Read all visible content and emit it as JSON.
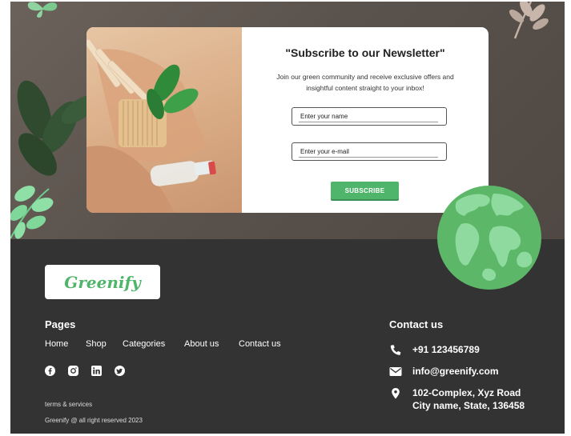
{
  "newsletter": {
    "title": "\"Subscribe to our Newsletter\"",
    "description": "Join our green community and receive exclusive offers and insightful content straight to your inbox!",
    "name_placeholder": "Enter your name",
    "email_placeholder": "Enter your e-mail",
    "button_label": "SUBSCRIBE"
  },
  "footer": {
    "logo_text": "Greenify",
    "pages_title": "Pages",
    "nav": [
      "Home",
      "Shop",
      "Categories",
      "About us",
      "Contact us"
    ],
    "socials": [
      "facebook-icon",
      "instagram-icon",
      "linkedin-icon",
      "twitter-icon"
    ],
    "terms": "terms & services",
    "copyright": "Greenify @ all right reserved 2023",
    "contact_title": "Contact us",
    "phone": "+91 123456789",
    "email": "info@greenify.com",
    "address_line1": "102-Complex, Xyz Road",
    "address_line2": "City name, State, 136458"
  },
  "colors": {
    "accent": "#4fb56a",
    "footer_bg": "#333333",
    "hero_bg": "#5f5751"
  }
}
